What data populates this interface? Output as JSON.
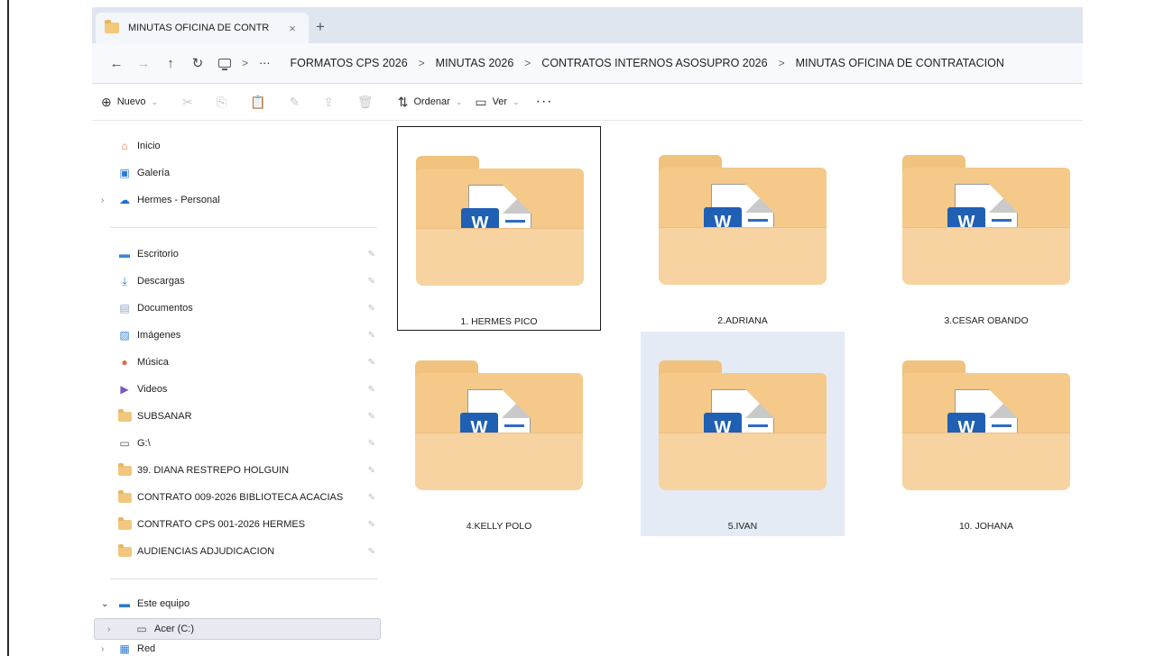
{
  "tab": {
    "title": "MINUTAS OFICINA DE CONTR",
    "close": "×",
    "add": "+"
  },
  "nav": {
    "back": "←",
    "forward": "→",
    "up": "↑",
    "refresh": "↻",
    "more": "···"
  },
  "breadcrumb": {
    "separator": ">",
    "items": [
      "FORMATOS CPS 2026",
      "MINUTAS 2026",
      "CONTRATOS INTERNOS ASOSUPRO 2026",
      "MINUTAS OFICINA DE CONTRATACION"
    ]
  },
  "toolbar": {
    "new_label": "Nuevo",
    "sort_label": "Ordenar",
    "view_label": "Ver",
    "more": "···"
  },
  "sidebar": {
    "top_items": [
      {
        "label": "Inicio",
        "icon": "home-icon"
      },
      {
        "label": "Galería",
        "icon": "gallery-icon"
      },
      {
        "label": "Hermes - Personal",
        "icon": "cloud-icon"
      }
    ],
    "pinned_items": [
      {
        "label": "Escritorio",
        "icon": "desktop-icon"
      },
      {
        "label": "Descargas",
        "icon": "download-icon"
      },
      {
        "label": "Documentos",
        "icon": "documents-icon"
      },
      {
        "label": "Imágenes",
        "icon": "pictures-icon"
      },
      {
        "label": "Música",
        "icon": "music-icon"
      },
      {
        "label": "Videos",
        "icon": "videos-icon"
      },
      {
        "label": "SUBSANAR",
        "icon": "folder-icon"
      },
      {
        "label": "G:\\",
        "icon": "drive-icon"
      },
      {
        "label": "39. DIANA RESTREPO HOLGUIN",
        "icon": "folder-icon"
      },
      {
        "label": "CONTRATO 009-2026 BIBLIOTECA ACACIAS",
        "icon": "folder-icon"
      },
      {
        "label": "CONTRATO CPS 001-2026 HERMES",
        "icon": "folder-icon"
      },
      {
        "label": "AUDIENCIAS ADJUDICACION",
        "icon": "folder-icon"
      }
    ],
    "bottom_items": [
      {
        "label": "Este equipo",
        "icon": "this-pc-icon"
      },
      {
        "label": "Acer (C:)",
        "icon": "drive-icon"
      },
      {
        "label": "Red",
        "icon": "network-icon"
      }
    ]
  },
  "folders": [
    {
      "label": "1. HERMES PICO"
    },
    {
      "label": "2.ADRIANA"
    },
    {
      "label": "3.CESAR OBANDO"
    },
    {
      "label": "4.KELLY POLO"
    },
    {
      "label": "5.IVAN"
    },
    {
      "label": "10. JOHANA"
    }
  ],
  "word_badge": "W",
  "colors": {
    "tabbar": "#dfe6f0",
    "folder": "#f4c98a",
    "word_blue": "#1f5fb4",
    "hover_tile": "#e4ebf5"
  }
}
